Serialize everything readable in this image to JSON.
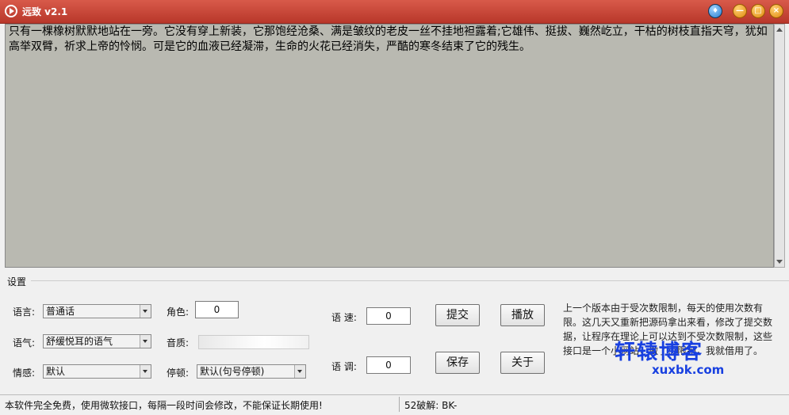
{
  "window": {
    "title": "远致 v2.1"
  },
  "editor": {
    "text": "只有一棵橡树默默地站在一旁。它没有穿上新装，它那饱经沧桑、满是皱纹的老皮一丝不挂地袒露着;它雄伟、挺拔、巍然屹立，干枯的树枝直指天穹，犹如高举双臂，祈求上帝的怜悯。可是它的血液已经凝滞，生命的火花已经消失，严酷的寒冬结束了它的残生。"
  },
  "settings": {
    "group_label": "设置",
    "language": {
      "label": "语言:",
      "value": "普通话"
    },
    "tone": {
      "label": "语气:",
      "value": "舒缓悦耳的语气"
    },
    "emotion": {
      "label": "情感:",
      "value": "默认"
    },
    "role": {
      "label": "角色:",
      "value": "0"
    },
    "quality": {
      "label": "音质:"
    },
    "pause": {
      "label": "停顿:",
      "value": "默认(句号停顿)"
    },
    "speed": {
      "label": "语 速:",
      "value": "0"
    },
    "pitch": {
      "label": "语 调:",
      "value": "0"
    }
  },
  "buttons": {
    "submit": "提交",
    "play": "播放",
    "save": "保存",
    "about": "关于"
  },
  "note": "上一个版本由于受次数限制，每天的使用次数有限。这几天又重新把源码拿出来看，修改了提交数据，让程序在理论上可以达到不受次数限制，这些接口是一个小网站，做了点限制，我就借用了。",
  "watermark": {
    "main": "轩辕博客",
    "sub": "xuxbk.com"
  },
  "status": {
    "left": "本软件完全免费，使用微软接口，每隔一段时间会修改，不能保证长期使用!",
    "right": "52破解: BK-"
  }
}
